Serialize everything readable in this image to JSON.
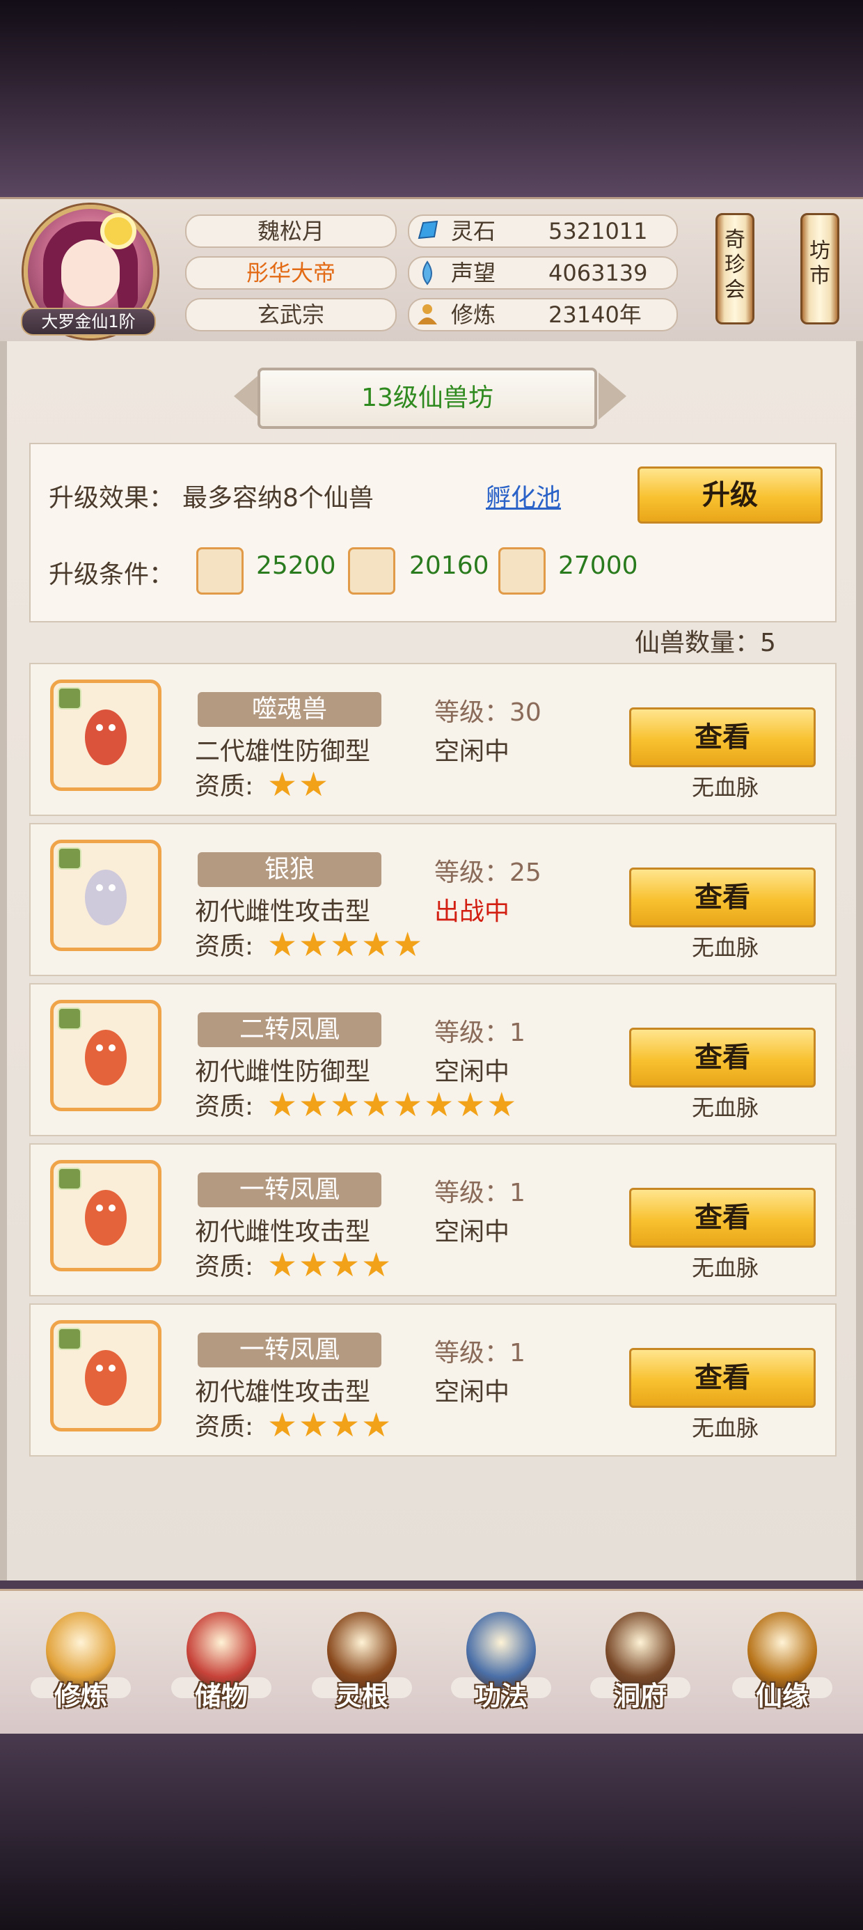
{
  "player": {
    "name": "魏松月",
    "title": "彤华大帝",
    "sect": "玄武宗",
    "rank": "大罗金仙1阶"
  },
  "resources": [
    {
      "icon": "spirit-stone-icon",
      "label": "灵石",
      "value": "5321011"
    },
    {
      "icon": "prestige-icon",
      "label": "声望",
      "value": "4063139"
    },
    {
      "icon": "cultivation-icon",
      "label": "修炼",
      "value": "23140年"
    }
  ],
  "side_buttons": {
    "treasure": "奇\n珍\n会",
    "market": "坊\n市"
  },
  "panel": {
    "title": "13级仙兽坊",
    "upgrade_effect_label": "升级效果：",
    "upgrade_effect_value": "最多容纳8个仙兽",
    "hatch_link": "孵化池",
    "upgrade_button": "升级",
    "upgrade_cond_label": "升级条件：",
    "materials": [
      {
        "icon": "ore-icon",
        "amount": "25200"
      },
      {
        "icon": "wood-icon",
        "amount": "20160"
      },
      {
        "icon": "herb-icon",
        "amount": "27000"
      }
    ],
    "pet_count": "仙兽数量：5"
  },
  "quality_label": "资质:",
  "view_label": "查看",
  "pets": [
    {
      "name": "噬魂兽",
      "type": "二代雄性防御型",
      "level": "等级：30",
      "status": "空闲中",
      "battle": false,
      "stars": 2,
      "bloodline": "无血脉",
      "art_color": "#d8412a"
    },
    {
      "name": "银狼",
      "type": "初代雌性攻击型",
      "level": "等级：25",
      "status": "出战中",
      "battle": true,
      "stars": 5,
      "bloodline": "无血脉",
      "art_color": "#c9c4dc"
    },
    {
      "name": "二转凤凰",
      "type": "初代雌性防御型",
      "level": "等级：1",
      "status": "空闲中",
      "battle": false,
      "stars": 8,
      "bloodline": "无血脉",
      "art_color": "#e2532a"
    },
    {
      "name": "一转凤凰",
      "type": "初代雌性攻击型",
      "level": "等级：1",
      "status": "空闲中",
      "battle": false,
      "stars": 4,
      "bloodline": "无血脉",
      "art_color": "#e2532a"
    },
    {
      "name": "一转凤凰",
      "type": "初代雄性攻击型",
      "level": "等级：1",
      "status": "空闲中",
      "battle": false,
      "stars": 4,
      "bloodline": "无血脉",
      "art_color": "#e2532a"
    }
  ],
  "nav": [
    {
      "label": "修炼",
      "icon": "meditation-icon",
      "color": "#e2a23a"
    },
    {
      "label": "储物",
      "icon": "storage-bag-icon",
      "color": "#c8433a"
    },
    {
      "label": "灵根",
      "icon": "spirit-root-icon",
      "color": "#8a4a1e"
    },
    {
      "label": "功法",
      "icon": "scroll-book-icon",
      "color": "#4a6fa8"
    },
    {
      "label": "洞府",
      "icon": "cave-mansion-icon",
      "color": "#7a4a2a"
    },
    {
      "label": "仙缘",
      "icon": "gourd-icon",
      "color": "#b8741a"
    }
  ]
}
